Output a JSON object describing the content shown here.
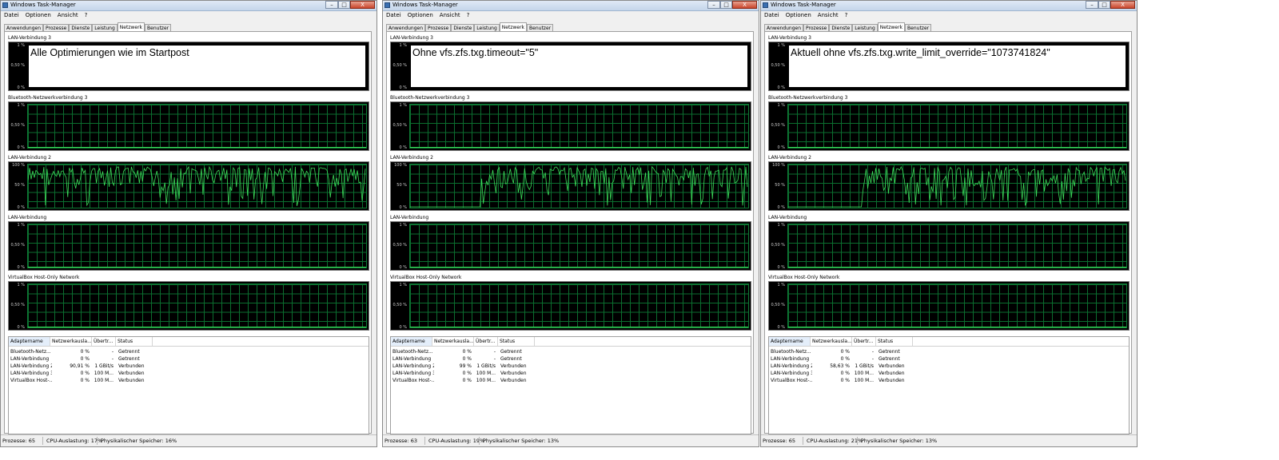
{
  "window_title": "Windows Task-Manager",
  "window_controls": {
    "minimize": "–",
    "maximize": "□",
    "close": "X"
  },
  "menu": [
    "Datei",
    "Optionen",
    "Ansicht",
    "?"
  ],
  "tabs": [
    "Anwendungen",
    "Prozesse",
    "Dienste",
    "Leistung",
    "Netzwerk",
    "Benutzer"
  ],
  "active_tab": "Netzwerk",
  "graph_titles": [
    "LAN-Verbindung 3",
    "Bluetooth-Netzwerkverbindung 3",
    "LAN-Verbindung 2",
    "LAN-Verbindung",
    "VirtualBox Host-Only Network"
  ],
  "graph_y_labels": {
    "small": [
      "1 %",
      "0,50 %",
      "0 %"
    ],
    "large": [
      "100 %",
      "50 %",
      "0 %"
    ]
  },
  "columns": [
    "Adaptername",
    "Netzwerkausla...",
    "Übertr...",
    "Status"
  ],
  "colors": {
    "graph_line": "#3cdc5a",
    "grid": "#0b6e2f",
    "graph_bg": "#000000"
  },
  "windows": [
    {
      "overlay_text": "Alle Optimierungen wie im Startpost",
      "rows": [
        [
          "Bluetooth-Netz...",
          "0 %",
          "-",
          "Getrennt"
        ],
        [
          "LAN-Verbindung",
          "0 %",
          "-",
          "Getrennt"
        ],
        [
          "LAN-Verbindung 2",
          "90,91 %",
          "1 GBit/s",
          "Verbunden"
        ],
        [
          "LAN-Verbindung 3",
          "0 %",
          "100 M...",
          "Verbunden"
        ],
        [
          "VirtualBox Host-...",
          "0 %",
          "100 M...",
          "Verbunden"
        ]
      ],
      "status": {
        "processes": "Prozesse: 65",
        "cpu": "CPU-Auslastung: 17%",
        "memory": "Physikalischer Speicher: 16%"
      },
      "lan2_activity_start": 0.0
    },
    {
      "overlay_text": "Ohne vfs.zfs.txg.timeout=\"5\"",
      "rows": [
        [
          "Bluetooth-Netz...",
          "0 %",
          "-",
          "Getrennt"
        ],
        [
          "LAN-Verbindung",
          "0 %",
          "-",
          "Getrennt"
        ],
        [
          "LAN-Verbindung 2",
          "99 %",
          "1 GBit/s",
          "Verbunden"
        ],
        [
          "LAN-Verbindung 3",
          "0 %",
          "100 M...",
          "Verbunden"
        ],
        [
          "VirtualBox Host-...",
          "0 %",
          "100 M...",
          "Verbunden"
        ]
      ],
      "status": {
        "processes": "Prozesse: 63",
        "cpu": "CPU-Auslastung: 19%",
        "memory": "Physikalischer Speicher: 13%"
      },
      "lan2_activity_start": 0.21
    },
    {
      "overlay_text": "Aktuell ohne vfs.zfs.txg.write_limit_override=\"1073741824\"",
      "rows": [
        [
          "Bluetooth-Netz...",
          "0 %",
          "-",
          "Getrennt"
        ],
        [
          "LAN-Verbindung",
          "0 %",
          "-",
          "Getrennt"
        ],
        [
          "LAN-Verbindung 2",
          "58,63 %",
          "1 GBit/s",
          "Verbunden"
        ],
        [
          "LAN-Verbindung 3",
          "0 %",
          "100 M...",
          "Verbunden"
        ],
        [
          "VirtualBox Host-...",
          "0 %",
          "100 M...",
          "Verbunden"
        ]
      ],
      "status": {
        "processes": "Prozesse: 65",
        "cpu": "CPU-Auslastung: 21%",
        "memory": "Physikalischer Speicher: 13%"
      },
      "lan2_activity_start": 0.22
    }
  ]
}
